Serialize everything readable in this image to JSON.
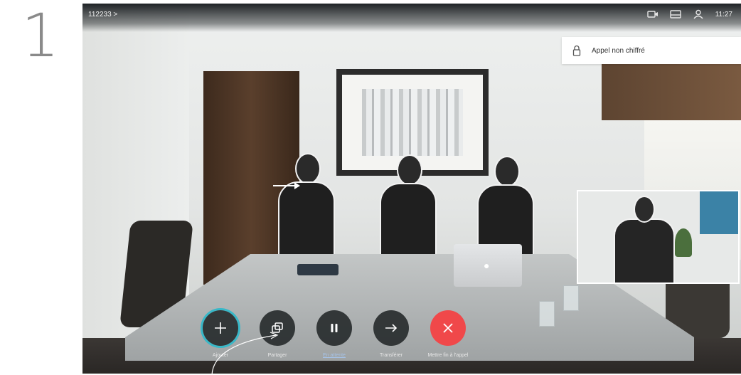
{
  "step_number": "1",
  "status_bar": {
    "caller": "112233 >",
    "time": "11:27",
    "icons": [
      "camera-icon",
      "display-icon",
      "contacts-icon"
    ]
  },
  "toast": {
    "icon": "lock-icon",
    "message": "Appel non chiffré"
  },
  "controls": [
    {
      "id": "add",
      "label": "Ajouter",
      "icon": "plus-icon"
    },
    {
      "id": "share",
      "label": "Partager",
      "icon": "share-icon"
    },
    {
      "id": "hold",
      "label": "En attente",
      "icon": "pause-icon"
    },
    {
      "id": "transfer",
      "label": "Transférer",
      "icon": "arrow-right-icon"
    },
    {
      "id": "end",
      "label": "Mettre fin à l'appel",
      "icon": "close-icon"
    }
  ],
  "colors": {
    "accent": "#38b8c8",
    "end_call": "#f0484a",
    "button_bg": "#282c2e",
    "hold_label": "#a6c3e8"
  }
}
